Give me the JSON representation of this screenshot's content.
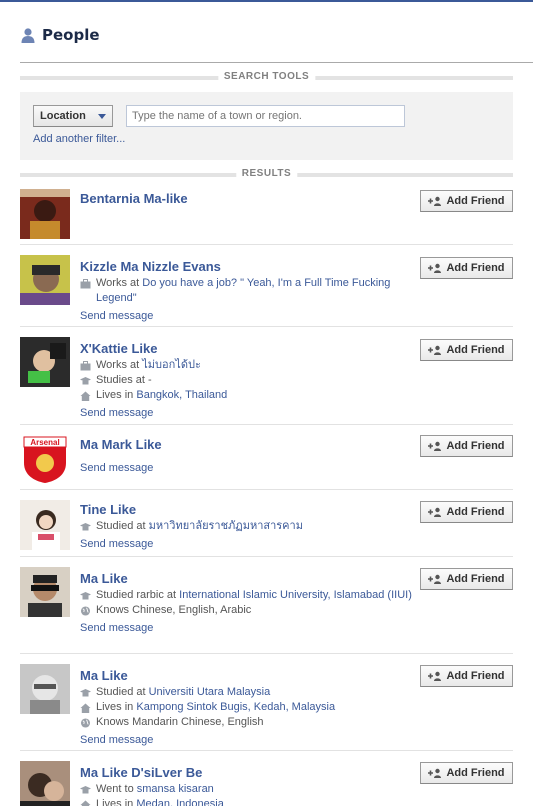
{
  "header": {
    "title": "People",
    "icon": "person-icon"
  },
  "search_tools": {
    "section_label": "SEARCH TOOLS",
    "filter_label": "Location",
    "input_placeholder": "Type the name of a town or region.",
    "add_filter": "Add another filter..."
  },
  "results_label": "RESULTS",
  "add_friend_label": "Add Friend",
  "send_message_label": "Send message",
  "results": [
    {
      "name": "Bentarnia Ma-like",
      "details": [],
      "send": false
    },
    {
      "name": "Kizzle Ma Nizzle Evans",
      "details": [
        {
          "icon": "briefcase-icon",
          "prefix": "Works at ",
          "link": "Do you have a job? \" Yeah, I'm a Full Time Fucking Legend\""
        }
      ],
      "send": true
    },
    {
      "name": "X'Kattie Like",
      "details": [
        {
          "icon": "briefcase-icon",
          "prefix": "Works at ",
          "link": "ไม่บอกได้ปะ"
        },
        {
          "icon": "graduation-cap-icon",
          "prefix": "Studies at -",
          "link": ""
        },
        {
          "icon": "home-icon",
          "prefix": "Lives in ",
          "link": "Bangkok, Thailand"
        }
      ],
      "send": true
    },
    {
      "name": "Ma Mark Like",
      "details": [],
      "send": true
    },
    {
      "name": "Tine Like",
      "details": [
        {
          "icon": "graduation-cap-icon",
          "prefix": "Studied at ",
          "link": "มหาวิทยาลัยราชภัฏมหาสารคาม"
        }
      ],
      "send": true
    },
    {
      "name": "Ma Like",
      "details": [
        {
          "icon": "graduation-cap-icon",
          "prefix": "Studied rarbic at ",
          "link": "International Islamic University, Islamabad (IIUI)"
        },
        {
          "icon": "globe-icon",
          "prefix": "Knows Chinese, English, Arabic",
          "link": ""
        }
      ],
      "send": true
    },
    {
      "name": "Ma Like",
      "details": [
        {
          "icon": "graduation-cap-icon",
          "prefix": "Studied at ",
          "link": "Universiti Utara Malaysia"
        },
        {
          "icon": "home-icon",
          "prefix": "Lives in ",
          "link": "Kampong Sintok Bugis, Kedah, Malaysia"
        },
        {
          "icon": "globe-icon",
          "prefix": "Knows Mandarin Chinese, English",
          "link": ""
        }
      ],
      "send": true
    },
    {
      "name": "Ma Like D'siLver Be",
      "details": [
        {
          "icon": "graduation-cap-icon",
          "prefix": "Went to ",
          "link": "smansa kisaran"
        },
        {
          "icon": "home-icon",
          "prefix": "Lives in ",
          "link": "Medan, Indonesia"
        }
      ],
      "send": false
    }
  ],
  "colors": {
    "link": "#3b5998",
    "title": "#1c2a47",
    "section_bar": "#e3e3e3",
    "search_bg": "#f2f2f2"
  }
}
